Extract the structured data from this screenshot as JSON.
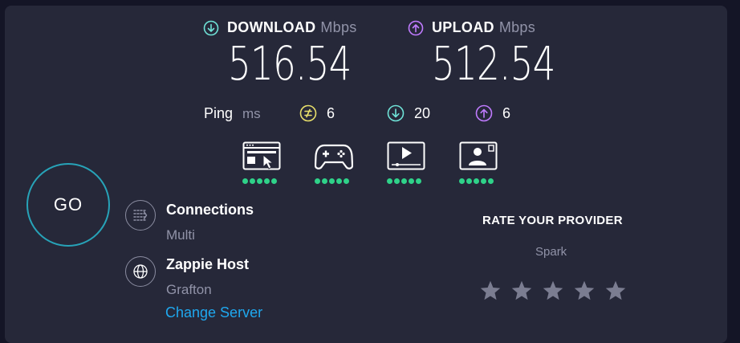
{
  "download": {
    "label": "DOWNLOAD",
    "unit": "Mbps",
    "value": "516.54"
  },
  "upload": {
    "label": "UPLOAD",
    "unit": "Mbps",
    "value": "512.54"
  },
  "ping": {
    "label": "Ping",
    "unit": "ms",
    "idle": "6",
    "download": "20",
    "upload": "6"
  },
  "quality": {
    "browsing": {
      "icon": "web-browsing-icon",
      "rating": 5
    },
    "gaming": {
      "icon": "gamepad-icon",
      "rating": 5
    },
    "streaming": {
      "icon": "video-streaming-icon",
      "rating": 5
    },
    "video_chat": {
      "icon": "video-chat-icon",
      "rating": 5
    }
  },
  "go": {
    "label": "GO"
  },
  "connections": {
    "title": "Connections",
    "value": "Multi"
  },
  "server": {
    "title": "Zappie Host",
    "location": "Grafton",
    "change_label": "Change Server"
  },
  "rate": {
    "title": "RATE YOUR PROVIDER",
    "provider": "Spark",
    "stars_max": 5,
    "stars_selected": 0
  },
  "colors": {
    "background": "#141526",
    "panel": "#262839",
    "download_accent": "#6fe3d8",
    "upload_accent": "#c07bff",
    "ping_accent": "#e9e06b",
    "good_dot": "#2fd289",
    "link": "#1fa8ef",
    "go_ring": "#27a3b8"
  }
}
